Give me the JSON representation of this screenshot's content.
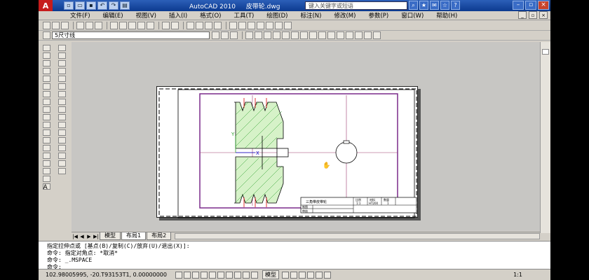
{
  "titlebar": {
    "logo": "A",
    "title": "AutoCAD 2010 　 皮带轮.dwg",
    "search_placeholder": "键入关键字或短语"
  },
  "menubar": {
    "items": [
      "文件(F)",
      "编辑(E)",
      "视图(V)",
      "插入(I)",
      "格式(O)",
      "工具(T)",
      "绘图(D)",
      "标注(N)",
      "修改(M)",
      "参数(P)",
      "窗口(W)",
      "帮助(H)"
    ]
  },
  "layers": {
    "current_layer": "5尺寸线"
  },
  "layout_tabs": [
    "模型",
    "布局1",
    "布局2"
  ],
  "active_tab": "布局1",
  "command": {
    "lines": [
      "指定拉伸点或 [基点(B)/复制(C)/放弃(U)/退出(X)]:",
      "命令: 指定对角点: *取消*",
      "命令: _.MSPACE",
      "命令:"
    ]
  },
  "status": {
    "coords": "102.98005995, -20.T93153T1, 0.00000000",
    "model_label": "模型",
    "scale": "1:1"
  },
  "title_block": {
    "name": "三角带皮带轮",
    "col1": "比例",
    "col2": "材料",
    "col3": "数量",
    "val1": "1:1",
    "val2": "HT200",
    "val3": "1",
    "row1": "制图",
    "row2": "审核"
  }
}
